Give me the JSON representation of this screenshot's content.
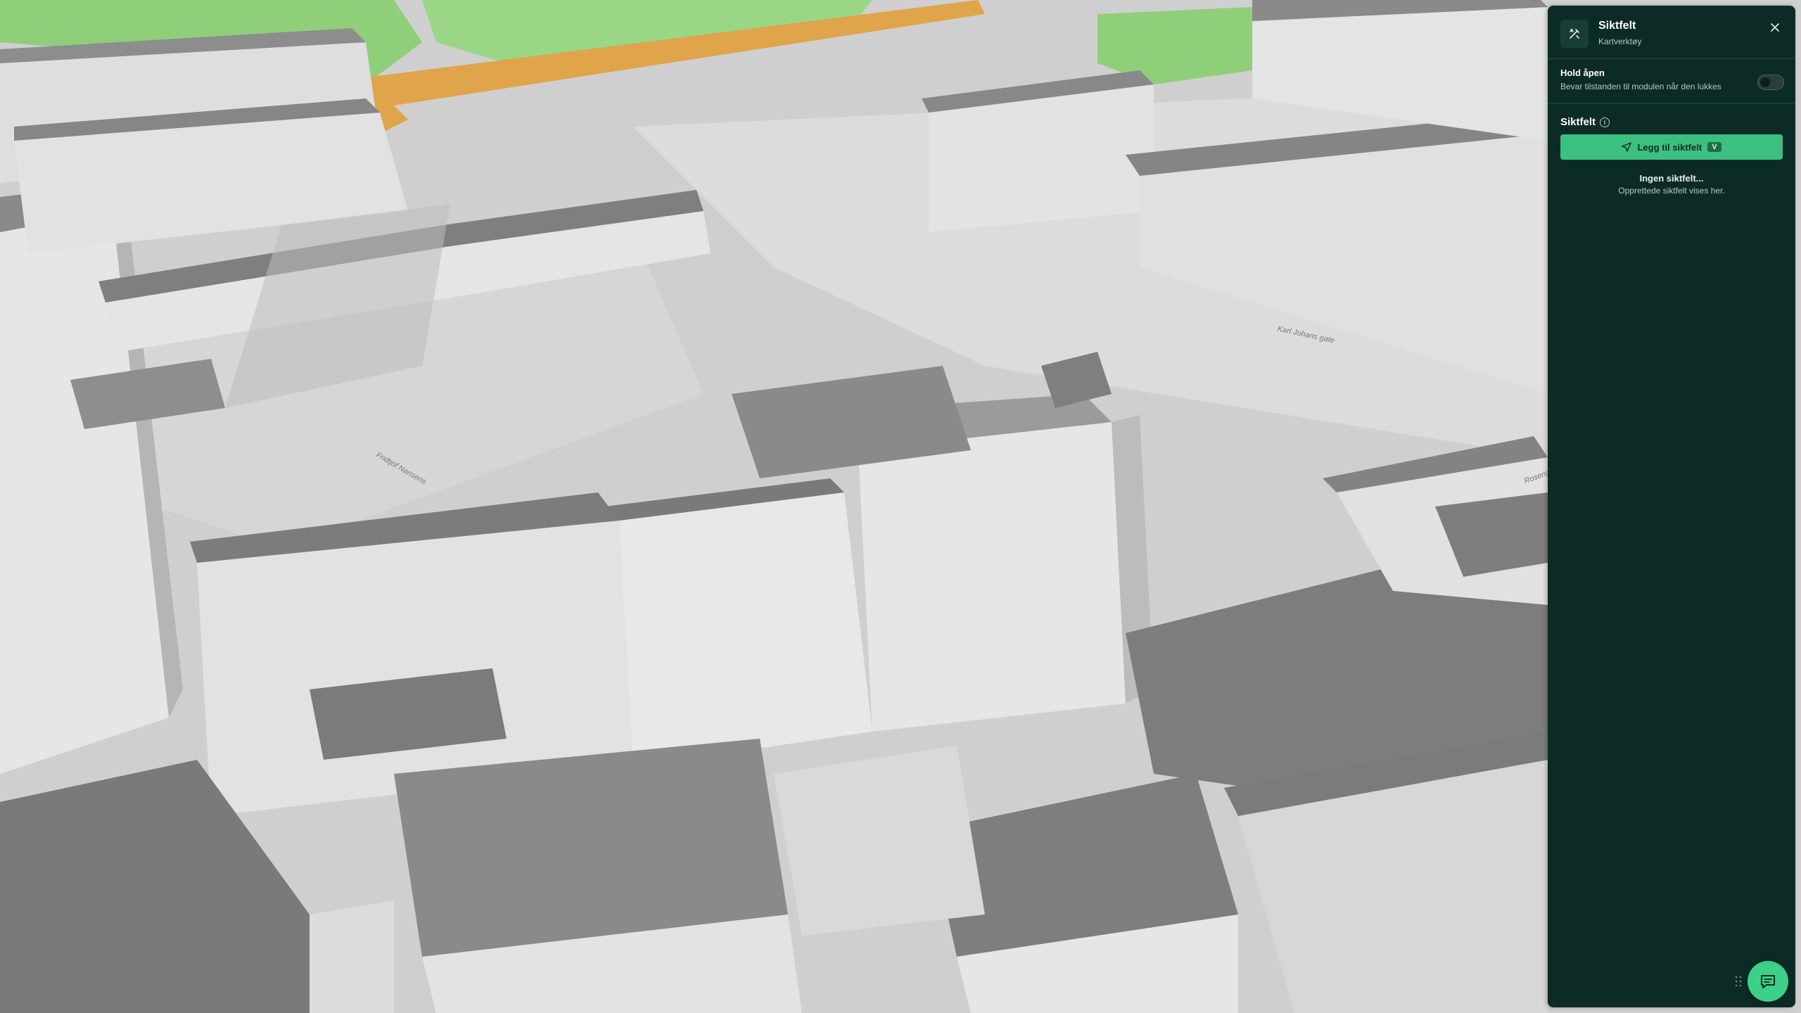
{
  "panel": {
    "title": "Siktfelt",
    "subtitle": "Kartverktøy",
    "tool_icon": "tools-icon",
    "close_icon": "close-icon",
    "hold_open": {
      "label": "Hold åpen",
      "description": "Bevar tilstanden til modulen når den lukkes",
      "enabled": false
    },
    "section_title": "Siktfelt",
    "info_icon": "info-icon",
    "add_button": {
      "label": "Legg til siktfelt",
      "shortcut": "V",
      "icon": "send-icon"
    },
    "empty_state": {
      "title": "Ingen siktfelt...",
      "description": "Opprettede siktfelt vises her."
    }
  },
  "map": {
    "street_labels": [
      "Karl Johans gate",
      "Fridtjof Nansens",
      "Roseng"
    ],
    "colors": {
      "park": "#8fcf7a",
      "road": "#e0a44a",
      "building_roof": "#8a8a8a",
      "building_wall": "#e4e4e4",
      "ground": "#cfcfcf"
    }
  },
  "chat_button": {
    "icon": "chat-icon"
  },
  "theme": {
    "panel_bg": "#0d2b26",
    "accent": "#3cc07f"
  }
}
